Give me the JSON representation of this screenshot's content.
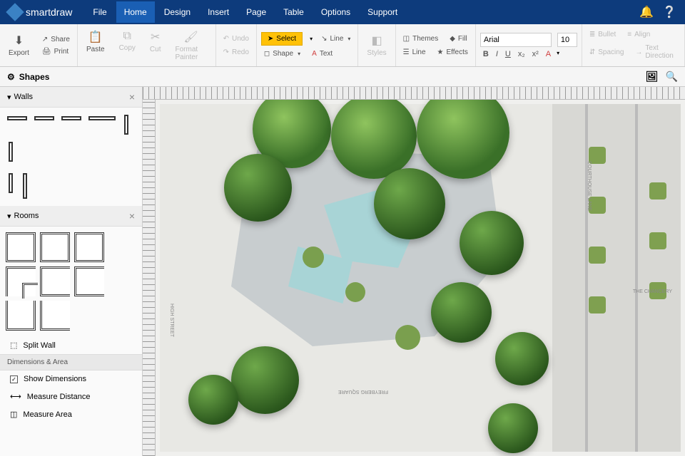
{
  "app": {
    "name": "smartdraw"
  },
  "menu": {
    "items": [
      "File",
      "Home",
      "Design",
      "Insert",
      "Page",
      "Table",
      "Options",
      "Support"
    ],
    "active_index": 1
  },
  "ribbon": {
    "export": "Export",
    "share": "Share",
    "print": "Print",
    "paste": "Paste",
    "copy": "Copy",
    "cut": "Cut",
    "format_painter": "Format Painter",
    "undo": "Undo",
    "redo": "Redo",
    "select": "Select",
    "shape": "Shape",
    "line": "Line",
    "text": "Text",
    "styles": "Styles",
    "themes": "Themes",
    "line_style": "Line",
    "fill": "Fill",
    "effects": "Effects",
    "font_name": "Arial",
    "font_size": "10",
    "bullet": "Bullet",
    "align": "Align",
    "spacing": "Spacing",
    "text_direction": "Text Direction"
  },
  "shapes_header": {
    "title": "Shapes"
  },
  "sidebar": {
    "panels": {
      "walls": {
        "title": "Walls"
      },
      "rooms": {
        "title": "Rooms"
      }
    },
    "split_wall": "Split Wall",
    "dimensions_section": "Dimensions & Area",
    "show_dimensions": "Show Dimensions",
    "measure_distance": "Measure Distance",
    "measure_area": "Measure Area"
  },
  "canvas": {
    "labels": {
      "high_street": "HIGH STREET",
      "freyberg_square": "FREYBERG SQUARE",
      "courthouse_lane": "COURTHOUSE LANE",
      "chancery": "THE CHANCERY"
    }
  }
}
